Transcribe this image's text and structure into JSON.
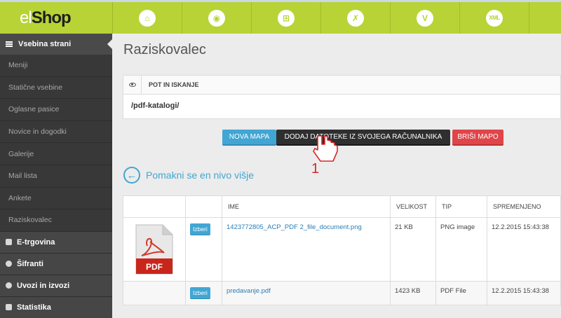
{
  "app": {
    "logo_el": "el",
    "logo_shop": "Shop"
  },
  "topnav": {
    "items": [
      {
        "name": "home",
        "icon": "home-icon",
        "glyph": "⌂"
      },
      {
        "name": "globe",
        "icon": "globe-icon",
        "glyph": "◉"
      },
      {
        "name": "add-module",
        "icon": "add-module-icon",
        "glyph": "⊞"
      },
      {
        "name": "tools",
        "icon": "tools-icon",
        "glyph": "✗"
      },
      {
        "name": "v-check",
        "icon": "v-icon",
        "glyph": "V"
      },
      {
        "name": "xml",
        "icon": "xml-icon",
        "glyph": "XML"
      },
      {
        "name": "extra",
        "icon": "extra-icon",
        "glyph": ""
      }
    ]
  },
  "sidebar": {
    "header": "Vsebina strani",
    "items": [
      {
        "label": "Meniji"
      },
      {
        "label": "Statične vsebine"
      },
      {
        "label": "Oglasne pasice"
      },
      {
        "label": "Novice in dogodki"
      },
      {
        "label": "Galerije"
      },
      {
        "label": "Mail lista"
      },
      {
        "label": "Ankete"
      },
      {
        "label": "Raziskovalec"
      }
    ],
    "sections": [
      {
        "label": "E-trgovina",
        "icon": "cart-icon"
      },
      {
        "label": "Šifranti",
        "icon": "info-icon"
      },
      {
        "label": "Uvozi in izvozi",
        "icon": "refresh-icon"
      },
      {
        "label": "Statistika",
        "icon": "stats-icon"
      }
    ]
  },
  "main": {
    "title": "Raziskovalec",
    "panel": {
      "title": "POT IN ISKANJE",
      "path": "/pdf-katalogi/"
    },
    "buttons": {
      "new_folder": "NOVA MAPA",
      "add_files": "DODAJ DATOTEKE IZ SVOJEGA RAČUNALNIKA",
      "delete_folder": "BRIŠI MAPO"
    },
    "annotation_number": "1",
    "back_link": "Pomakni se en nivo višje",
    "table": {
      "columns": [
        "",
        "",
        "IME",
        "VELIKOST",
        "TIP",
        "SPREMENJENO"
      ],
      "rows": [
        {
          "select": "Izberi",
          "name": "1423772805_ACP_PDF 2_file_document.png",
          "size": "21 KB",
          "type": "PNG image",
          "modified": "12.2.2015 15:43:38",
          "thumb_label": "PDF"
        },
        {
          "select": "Izberi",
          "name": "predavanje.pdf",
          "size": "1423 KB",
          "type": "PDF File",
          "modified": "12.2.2015 15:43:38"
        }
      ]
    }
  },
  "colors": {
    "accent_green": "#b8d335",
    "button_blue": "#41a6d3",
    "button_dark": "#2f2f2f",
    "button_red": "#e0454a",
    "sidebar_bg": "#3a3a3a"
  }
}
